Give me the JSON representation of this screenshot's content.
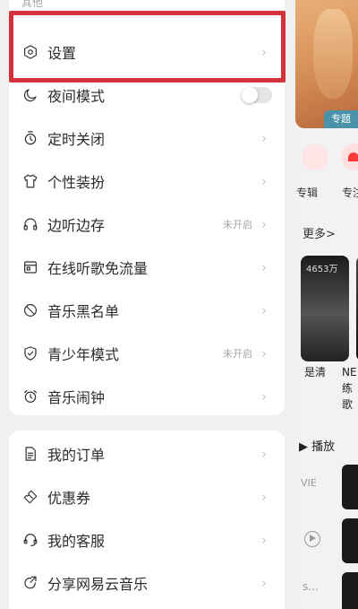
{
  "background": {
    "banner_tag": "专题",
    "label_album": "专辑",
    "label_partial": "专注",
    "more": "更多>",
    "play_count": "4653万",
    "caption1": "是清",
    "caption2_line1": "NE",
    "caption2_line2": "练歌",
    "play_header": "▶ 播放",
    "vie": "VIE",
    "dots": "s..."
  },
  "drawer": {
    "section_title": "其他",
    "items": [
      {
        "label": "设置",
        "icon": "hexagon-gear-icon"
      },
      {
        "label": "夜间模式",
        "icon": "moon-icon",
        "toggle": false
      },
      {
        "label": "定时关闭",
        "icon": "timer-icon"
      },
      {
        "label": "个性装扮",
        "icon": "tshirt-icon"
      },
      {
        "label": "边听边存",
        "icon": "headphones-icon",
        "status": "未开启"
      },
      {
        "label": "在线听歌免流量",
        "icon": "sim-card-icon"
      },
      {
        "label": "音乐黑名单",
        "icon": "block-icon"
      },
      {
        "label": "青少年模式",
        "icon": "shield-check-icon",
        "status": "未开启"
      },
      {
        "label": "音乐闹钟",
        "icon": "alarm-clock-icon"
      }
    ],
    "items2": [
      {
        "label": "我的订单",
        "icon": "document-icon"
      },
      {
        "label": "优惠券",
        "icon": "coupon-icon"
      },
      {
        "label": "我的客服",
        "icon": "headset-icon"
      },
      {
        "label": "分享网易云音乐",
        "icon": "share-icon"
      }
    ]
  },
  "colors": {
    "highlight": "#d4323b",
    "accent_red": "#ff3a3a"
  }
}
